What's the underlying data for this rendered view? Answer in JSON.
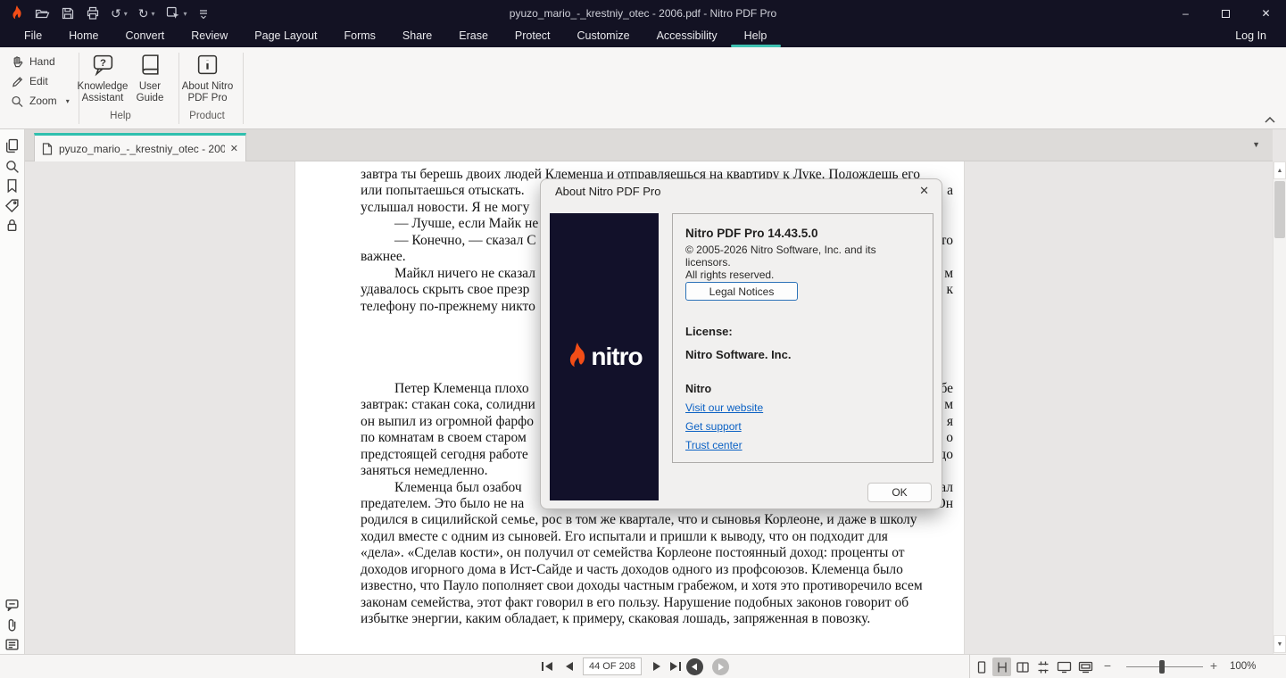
{
  "app": {
    "window_title": "pyuzo_mario_-_krestniy_otec - 2006.pdf - Nitro PDF Pro"
  },
  "menu": {
    "tabs": [
      "File",
      "Home",
      "Convert",
      "Review",
      "Page Layout",
      "Forms",
      "Share",
      "Erase",
      "Protect",
      "Customize",
      "Accessibility",
      "Help"
    ],
    "active_tab": "Help",
    "login": "Log In"
  },
  "ribbon": {
    "hand": "Hand",
    "edit": "Edit",
    "zoom": "Zoom",
    "knowledge_assistant": "Knowledge Assistant",
    "user_guide": "User Guide",
    "about": "About Nitro PDF Pro",
    "group_help": "Help",
    "group_product": "Product"
  },
  "doc_tab": {
    "title": "pyuzo_mario_-_krestniy_otec - 200..."
  },
  "dialog": {
    "title": "About Nitro PDF Pro",
    "version": "Nitro PDF Pro 14.43.5.0",
    "copyright_line1": "© 2005-2026 Nitro Software, Inc. and its licensors.",
    "copyright_line2": "All rights reserved.",
    "legal_button": "Legal Notices",
    "license_label": "License:",
    "license_value": "Nitro Software. Inc.",
    "company": "Nitro",
    "links": [
      "Visit our website",
      "Get support",
      "Trust center"
    ],
    "ok_button": "OK",
    "logo_text": "nitro"
  },
  "page": {
    "lines": [
      {
        "s": 0,
        "i": 0,
        "t": "завтра ты берешь двоих людей Клеменца и отправляешься на квартиру к Луке. Подождешь его",
        "f": ""
      },
      {
        "s": 1,
        "i": 0,
        "t": "или попытаешься отыскать.",
        "f": "а"
      },
      {
        "s": 2,
        "i": 0,
        "t": "услышал новости. Я не могу",
        "f": ""
      },
      {
        "s": 3,
        "i": 1,
        "t": "— Лучше, если Майк не",
        "f": ""
      },
      {
        "s": 4,
        "i": 1,
        "t": "— Конечно, — сказал С",
        "f": "то"
      },
      {
        "s": 5,
        "i": 0,
        "t": "важнее.",
        "f": ""
      },
      {
        "s": 6,
        "i": 1,
        "t": "Майкл ничего не сказал",
        "f": "м"
      },
      {
        "s": 7,
        "i": 0,
        "t": "удавалось скрыть свое презр",
        "f": "к"
      },
      {
        "s": 8,
        "i": 0,
        "t": "телефону по-прежнему никто",
        "f": ""
      },
      {
        "s": 13,
        "i": 1,
        "t": "Петер Клеменца плохо",
        "f": "бе"
      },
      {
        "s": 14,
        "i": 0,
        "t": "завтрак: стакан сока, солидни",
        "f": "м"
      },
      {
        "s": 15,
        "i": 0,
        "t": "он выпил из огромной фарфо",
        "f": "я"
      },
      {
        "s": 16,
        "i": 0,
        "t": "по комнатам в своем старом",
        "f": "о"
      },
      {
        "s": 17,
        "i": 0,
        "t": "предстоящей сегодня работе",
        "f": "до"
      },
      {
        "s": 18,
        "i": 0,
        "t": "заняться немедленно.",
        "f": ""
      },
      {
        "s": 19,
        "i": 1,
        "t": "Клеменца был озабоч",
        "f": "ал"
      },
      {
        "s": 20,
        "i": 0,
        "t": "предателем. Это было не на",
        "f": "Он"
      },
      {
        "s": 21,
        "i": 0,
        "t": "родился в сицилийской семье, рос в том же квартале, что и сыновья Корлеоне, и даже в школу",
        "f": ""
      },
      {
        "s": 22,
        "i": 0,
        "t": "ходил вместе с одним из сыновей. Его испытали и пришли к выводу, что он подходит для",
        "f": ""
      },
      {
        "s": 23,
        "i": 0,
        "t": "«дела». «Сделав кости», он получил от семейства Корлеоне постоянный доход: проценты от",
        "f": ""
      },
      {
        "s": 24,
        "i": 0,
        "t": "доходов игорного дома в Ист-Сайде и часть доходов одного из профсоюзов. Клеменца было",
        "f": ""
      },
      {
        "s": 25,
        "i": 0,
        "t": "известно, что Пауло пополняет свои доходы частным грабежом, и хотя это противоречило всем",
        "f": ""
      },
      {
        "s": 26,
        "i": 0,
        "t": "законам семейства, этот факт говорил в его пользу. Нарушение подобных законов говорит об",
        "f": ""
      },
      {
        "s": 27,
        "i": 0,
        "t": "избытке энергии, каким обладает, к примеру, скаковая лошадь, запряженная в повозку.",
        "f": ""
      }
    ]
  },
  "statusbar": {
    "page_indicator": "44 OF 208",
    "zoom_level": "100%"
  },
  "icons": {
    "close_glyph": "✕",
    "caret_down": "▾",
    "triangle_up": "▲",
    "triangle_down": "▼",
    "minimize_glyph": "–",
    "minus": "−",
    "plus": "+"
  },
  "colors": {
    "titlebar": "#131223",
    "accent_teal": "#3fc2b2",
    "nitro_orange": "#f24d17",
    "link_blue": "#0b61c4"
  }
}
